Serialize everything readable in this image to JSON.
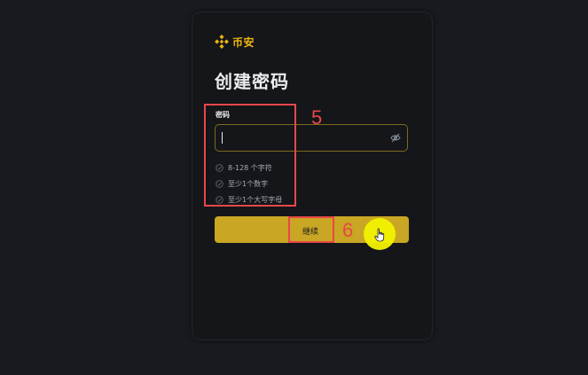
{
  "brand": {
    "name": "币安",
    "color": "#f0b90b",
    "icon": "binance-logo-icon"
  },
  "form": {
    "title": "创建密码",
    "password_label": "密码",
    "password_value": "",
    "visibility_icon": "eye-slash-icon",
    "rules": [
      {
        "text": "8-128 个字符",
        "icon": "check-circle-icon"
      },
      {
        "text": "至少1个数字",
        "icon": "check-circle-icon"
      },
      {
        "text": "至少1个大写字母",
        "icon": "check-circle-icon"
      }
    ],
    "continue_label": "继续",
    "accent": "#c9a623"
  },
  "annotations": {
    "step_5": "5",
    "step_6": "6",
    "color": "#e8474a"
  },
  "cursor": {
    "icon": "hand-pointer-icon",
    "highlight_color": "#f2f200"
  }
}
